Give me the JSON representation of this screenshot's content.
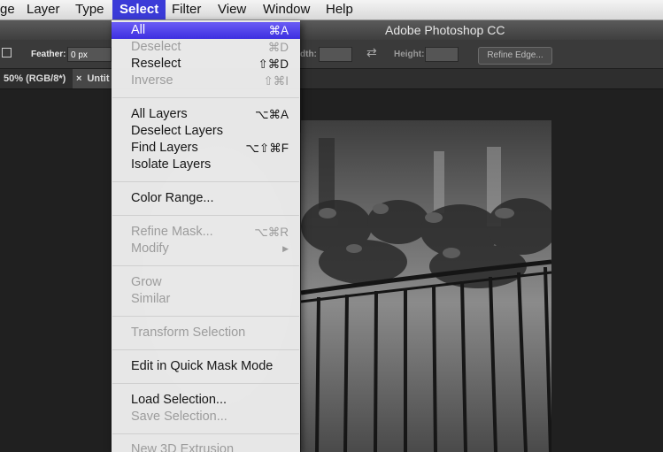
{
  "menubar": {
    "items": [
      "ge",
      "Layer",
      "Type",
      "Select",
      "Filter",
      "View",
      "Window",
      "Help"
    ],
    "active": "Select"
  },
  "window": {
    "title": "Adobe Photoshop CC"
  },
  "options": {
    "feather_label": "Feather:",
    "feather_value": "0 px",
    "width_label": "dth:",
    "height_label": "Height:",
    "refine_button": "Refine Edge..."
  },
  "tabs": [
    "50% (RGB/8*)",
    "Untit"
  ],
  "tab_close": "×",
  "menu": {
    "items": [
      {
        "label": "All",
        "shortcut": "⌘A",
        "state": "highlighted"
      },
      {
        "label": "Deselect",
        "shortcut": "⌘D",
        "state": "disabled"
      },
      {
        "label": "Reselect",
        "shortcut": "⇧⌘D",
        "state": "enabled"
      },
      {
        "label": "Inverse",
        "shortcut": "⇧⌘I",
        "state": "disabled"
      },
      {
        "label": "All Layers",
        "shortcut": "⌥⌘A",
        "state": "enabled"
      },
      {
        "label": "Deselect Layers",
        "shortcut": "",
        "state": "enabled"
      },
      {
        "label": "Find Layers",
        "shortcut": "⌥⇧⌘F",
        "state": "enabled"
      },
      {
        "label": "Isolate Layers",
        "shortcut": "",
        "state": "enabled"
      },
      {
        "label": "Color Range...",
        "shortcut": "",
        "state": "enabled"
      },
      {
        "label": "Refine Mask...",
        "shortcut": "⌥⌘R",
        "state": "disabled"
      },
      {
        "label": "Modify",
        "shortcut": "▶",
        "state": "disabled"
      },
      {
        "label": "Grow",
        "shortcut": "",
        "state": "disabled"
      },
      {
        "label": "Similar",
        "shortcut": "",
        "state": "disabled"
      },
      {
        "label": "Transform Selection",
        "shortcut": "",
        "state": "disabled"
      },
      {
        "label": "Edit in Quick Mask Mode",
        "shortcut": "",
        "state": "enabled"
      },
      {
        "label": "Load Selection...",
        "shortcut": "",
        "state": "enabled"
      },
      {
        "label": "Save Selection...",
        "shortcut": "",
        "state": "disabled"
      },
      {
        "label": "New 3D Extrusion",
        "shortcut": "",
        "state": "disabled"
      }
    ]
  },
  "colors": {
    "highlight": "#4a3cea",
    "menubar_active": "#3b3bd8",
    "disabled_text": "#9c9c9c"
  }
}
